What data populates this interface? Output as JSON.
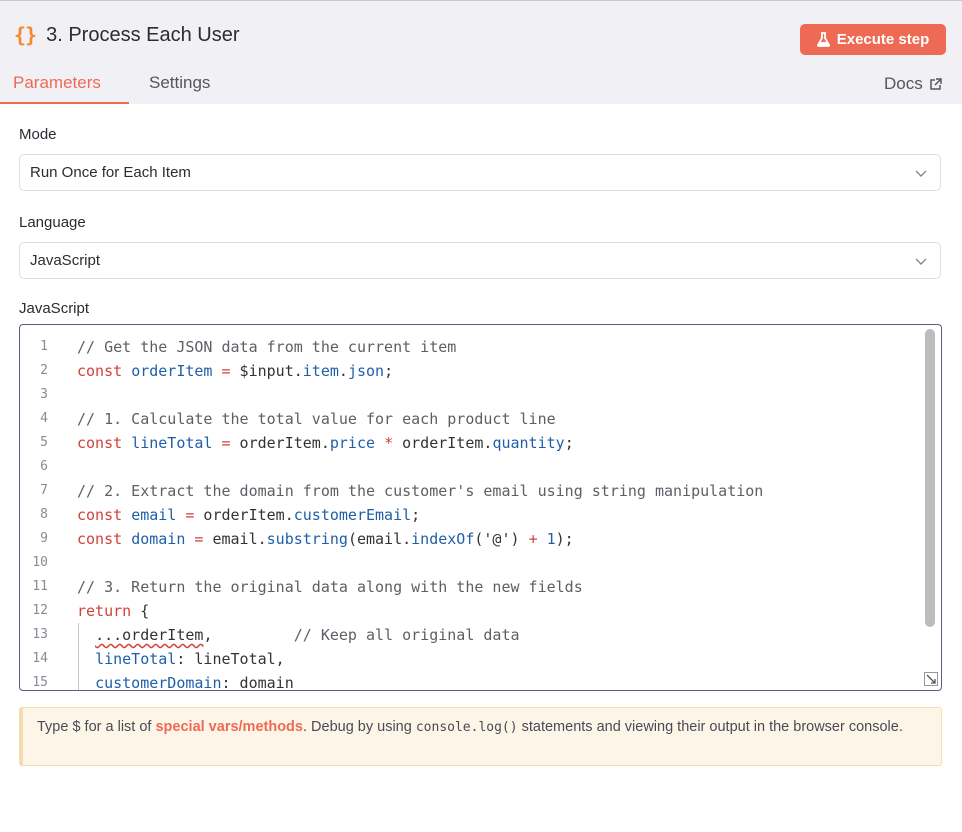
{
  "node": {
    "icon": "code-braces-icon",
    "title": "3. Process Each User"
  },
  "actions": {
    "execute_label": "Execute step",
    "execute_icon": "flask-icon"
  },
  "tabs": [
    {
      "label": "Parameters",
      "active": true
    },
    {
      "label": "Settings",
      "active": false
    }
  ],
  "docs": {
    "label": "Docs",
    "icon": "external-link-icon"
  },
  "fields": {
    "mode": {
      "label": "Mode",
      "value": "Run Once for Each Item"
    },
    "language": {
      "label": "Language",
      "value": "JavaScript"
    },
    "code_label": "JavaScript"
  },
  "editor": {
    "line_numbers": [
      "1",
      "2",
      "3",
      "4",
      "5",
      "6",
      "7",
      "8",
      "9",
      "10",
      "11",
      "12",
      "13",
      "14",
      "15"
    ],
    "lines": [
      "// Get the JSON data from the current item",
      "const orderItem = $input.item.json;",
      "",
      "// 1. Calculate the total value for each product line",
      "const lineTotal = orderItem.price * orderItem.quantity;",
      "",
      "// 2. Extract the domain from the customer's email using string manipulation",
      "const email = orderItem.customerEmail;",
      "const domain = email.substring(email.indexOf('@') + 1);",
      "",
      "// 3. Return the original data along with the new fields",
      "return {",
      "  ...orderItem,         // Keep all original data",
      "  lineTotal: lineTotal,",
      "  customerDomain: domain"
    ]
  },
  "notice": {
    "prefix": "Type $ for a list of ",
    "link": "special vars/methods",
    "middle": ". Debug by using ",
    "code": "console.log()",
    "suffix": " statements and viewing their output in the browser console."
  },
  "colors": {
    "accent": "#ef6a55",
    "brace_icon": "#f5872f",
    "notice_bg": "#fdf6e8"
  }
}
